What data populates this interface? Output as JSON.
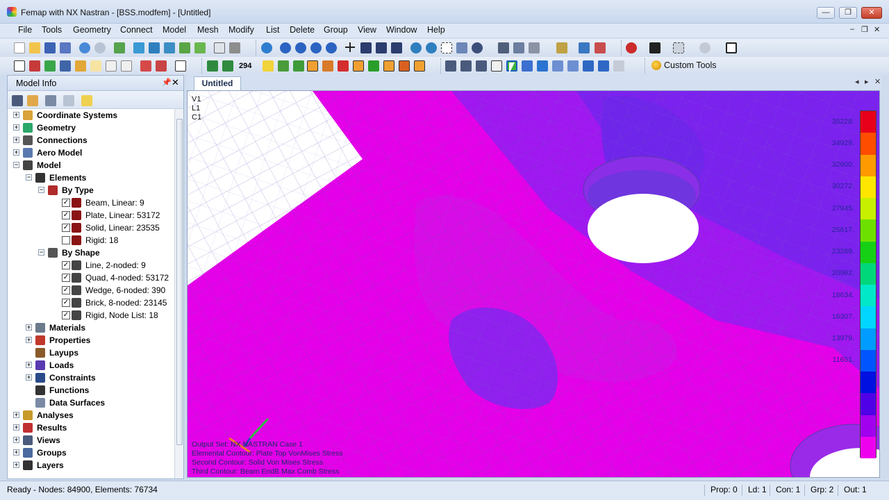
{
  "window": {
    "title": "Femap with NX Nastran - [BSS.modfem] - [Untitled]",
    "controls": {
      "minimize": "—",
      "maximize": "❐",
      "close": "✕"
    }
  },
  "menu": [
    "File",
    "Tools",
    "Geometry",
    "Connect",
    "Model",
    "Mesh",
    "Modify",
    "List",
    "Delete",
    "Group",
    "View",
    "Window",
    "Help"
  ],
  "mdi_controls": {
    "minimize": "–",
    "restore": "❐",
    "close": "✕"
  },
  "toolbar": {
    "custom_tools_label": "Custom Tools",
    "counter_label": "294"
  },
  "model_info": {
    "title": "Model Info",
    "pin": "📌",
    "close": "✕",
    "tree": [
      {
        "label": "Coordinate Systems",
        "depth": 0,
        "bold": true,
        "icon": "coordinate-icon",
        "expander": "+"
      },
      {
        "label": "Geometry",
        "depth": 0,
        "bold": true,
        "icon": "geometry-icon",
        "expander": "+"
      },
      {
        "label": "Connections",
        "depth": 0,
        "bold": true,
        "icon": "connections-icon",
        "expander": "+"
      },
      {
        "label": "Aero Model",
        "depth": 0,
        "bold": true,
        "icon": "aero-icon",
        "expander": "+"
      },
      {
        "label": "Model",
        "depth": 0,
        "bold": true,
        "icon": "model-icon",
        "expander": "−"
      },
      {
        "label": "Elements",
        "depth": 1,
        "bold": true,
        "icon": "elements-icon",
        "expander": "−"
      },
      {
        "label": "By Type",
        "depth": 2,
        "bold": true,
        "icon": "by-type-icon",
        "expander": "−"
      },
      {
        "label": "Beam, Linear: 9",
        "depth": 3,
        "bold": false,
        "icon": "element-type-icon",
        "checked": true
      },
      {
        "label": "Plate, Linear: 53172",
        "depth": 3,
        "bold": false,
        "icon": "element-type-icon",
        "checked": true
      },
      {
        "label": "Solid, Linear: 23535",
        "depth": 3,
        "bold": false,
        "icon": "element-type-icon",
        "checked": true
      },
      {
        "label": "Rigid: 18",
        "depth": 3,
        "bold": false,
        "icon": "element-type-icon",
        "checked": false
      },
      {
        "label": "By Shape",
        "depth": 2,
        "bold": true,
        "icon": "by-shape-icon",
        "expander": "−"
      },
      {
        "label": "Line, 2-noded: 9",
        "depth": 3,
        "bold": false,
        "icon": "shape-icon",
        "checked": true
      },
      {
        "label": "Quad, 4-noded: 53172",
        "depth": 3,
        "bold": false,
        "icon": "shape-icon",
        "checked": true
      },
      {
        "label": "Wedge, 6-noded: 390",
        "depth": 3,
        "bold": false,
        "icon": "shape-icon",
        "checked": true
      },
      {
        "label": "Brick, 8-noded: 23145",
        "depth": 3,
        "bold": false,
        "icon": "shape-icon",
        "checked": true
      },
      {
        "label": "Rigid, Node List: 18",
        "depth": 3,
        "bold": false,
        "icon": "shape-icon",
        "checked": true
      },
      {
        "label": "Materials",
        "depth": 1,
        "bold": true,
        "icon": "materials-icon",
        "expander": "+"
      },
      {
        "label": "Properties",
        "depth": 1,
        "bold": true,
        "icon": "properties-icon",
        "expander": "+"
      },
      {
        "label": "Layups",
        "depth": 1,
        "bold": true,
        "icon": "layups-icon"
      },
      {
        "label": "Loads",
        "depth": 1,
        "bold": true,
        "icon": "loads-icon",
        "expander": "+"
      },
      {
        "label": "Constraints",
        "depth": 1,
        "bold": true,
        "icon": "constraints-icon",
        "expander": "+"
      },
      {
        "label": "Functions",
        "depth": 1,
        "bold": true,
        "icon": "functions-icon"
      },
      {
        "label": "Data Surfaces",
        "depth": 1,
        "bold": true,
        "icon": "data-surfaces-icon"
      },
      {
        "label": "Analyses",
        "depth": 0,
        "bold": true,
        "icon": "analyses-icon",
        "expander": "+"
      },
      {
        "label": "Results",
        "depth": 0,
        "bold": true,
        "icon": "results-icon",
        "expander": "+"
      },
      {
        "label": "Views",
        "depth": 0,
        "bold": true,
        "icon": "views-icon",
        "expander": "+"
      },
      {
        "label": "Groups",
        "depth": 0,
        "bold": true,
        "icon": "groups-icon",
        "expander": "+"
      },
      {
        "label": "Layers",
        "depth": 0,
        "bold": true,
        "icon": "layers-icon",
        "expander": "+"
      }
    ]
  },
  "view_tab": {
    "label": "Untitled"
  },
  "viewport": {
    "corner_labels": [
      "V1",
      "L1",
      "C1"
    ],
    "info_lines": [
      "Output Set: NX NASTRAN Case 1",
      "Elemental Contour: Plate Top VonMises Stress",
      "Second Contour: Solid Von Mises Stress",
      "Third Contour: Beam EndB Max Comb Stress"
    ]
  },
  "legend": {
    "values": [
      "35228.",
      "34929.",
      "32600.",
      "30272.",
      "27945.",
      "25617.",
      "23289.",
      "20962.",
      "18634.",
      "16307.",
      "13979.",
      "11651.",
      "",
      "",
      ""
    ],
    "colors": [
      "#e8001b",
      "#ff4d00",
      "#ff9a00",
      "#ffe600",
      "#c6f000",
      "#6ee000",
      "#16d016",
      "#00d77a",
      "#00e8c8",
      "#00d6ff",
      "#009cff",
      "#0055ff",
      "#0010e0",
      "#5000e6",
      "#a000ee",
      "#ee00ee"
    ]
  },
  "status": {
    "main": "Ready - Nodes: 84900,  Elements: 76734",
    "prop": "Prop: 0",
    "ld": "Ld: 1",
    "con": "Con: 1",
    "grp": "Grp: 2",
    "out": "Out: 1"
  }
}
